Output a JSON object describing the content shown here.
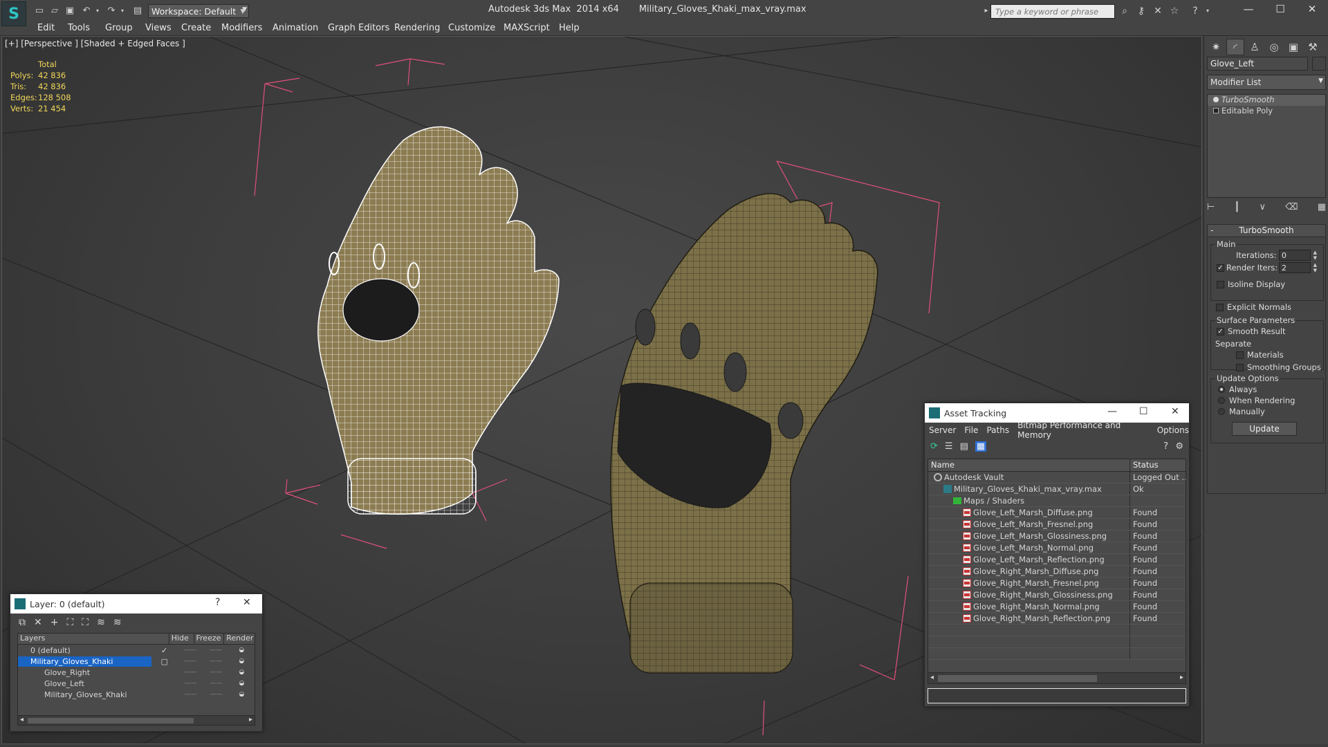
{
  "titlebar": {
    "title": "Autodesk 3ds Max  2014 x64       Military_Gloves_Khaki_max_vray.max",
    "workspace": "Workspace: Default",
    "search_placeholder": "Type a keyword or phrase"
  },
  "menu": [
    "Edit",
    "Tools",
    "Group",
    "Views",
    "Create",
    "Modifiers",
    "Animation",
    "Graph Editors",
    "Rendering",
    "Customize",
    "MAXScript",
    "Help"
  ],
  "viewport": {
    "label": "[+] [Perspective ] [Shaded + Edged Faces ]",
    "stats": {
      "header": "Total",
      "rows": [
        {
          "key": "Polys:",
          "value": "42 836"
        },
        {
          "key": "Tris:",
          "value": "42 836"
        },
        {
          "key": "Edges:",
          "value": "128 508"
        },
        {
          "key": "Verts:",
          "value": "21 454"
        }
      ]
    }
  },
  "command_panel": {
    "object_name": "Glove_Left",
    "modifier_list": "Modifier List",
    "stack": [
      "TurboSmooth",
      "Editable Poly"
    ],
    "turbosmooth": {
      "title": "TurboSmooth",
      "main_label": "Main",
      "iterations_label": "Iterations:",
      "iterations_value": "0",
      "render_iters_label": "Render Iters:",
      "render_iters_value": "2",
      "isoline_label": "Isoline Display",
      "explicit_normals_label": "Explicit Normals",
      "surface_params_label": "Surface Parameters",
      "smooth_result_label": "Smooth Result",
      "separate_label": "Separate",
      "materials_label": "Materials",
      "smoothing_groups_label": "Smoothing Groups",
      "update_options_label": "Update Options",
      "always_label": "Always",
      "when_rendering_label": "When Rendering",
      "manually_label": "Manually",
      "update_button": "Update"
    }
  },
  "layer_window": {
    "title": "Layer: 0 (default)",
    "help": "?",
    "columns": [
      "Layers",
      "Hide",
      "Freeze",
      "Render"
    ],
    "rows": [
      {
        "name": "0 (default)",
        "indent": 1
      },
      {
        "name": "Military_Gloves_Khaki",
        "indent": 1
      },
      {
        "name": "Glove_Right",
        "indent": 2
      },
      {
        "name": "Glove_Left",
        "indent": 2
      },
      {
        "name": "Military_Gloves_Khaki",
        "indent": 2
      }
    ]
  },
  "asset_window": {
    "title": "Asset Tracking",
    "menu": [
      "Server",
      "File",
      "Paths",
      "Bitmap Performance and Memory",
      "Options"
    ],
    "columns": [
      "Name",
      "Status"
    ],
    "rows": [
      {
        "name": "Autodesk Vault",
        "status": "Logged Out ...",
        "icon": "vault-icon",
        "indent": 1
      },
      {
        "name": "Military_Gloves_Khaki_max_vray.max",
        "status": "Ok",
        "icon": "max-file-icon",
        "indent": 2
      },
      {
        "name": "Maps / Shaders",
        "status": "",
        "icon": "folder-icon",
        "indent": 3
      },
      {
        "name": "Glove_Left_Marsh_Diffuse.png",
        "status": "Found",
        "icon": "png-icon",
        "indent": 4
      },
      {
        "name": "Glove_Left_Marsh_Fresnel.png",
        "status": "Found",
        "icon": "png-icon",
        "indent": 4
      },
      {
        "name": "Glove_Left_Marsh_Glossiness.png",
        "status": "Found",
        "icon": "png-icon",
        "indent": 4
      },
      {
        "name": "Glove_Left_Marsh_Normal.png",
        "status": "Found",
        "icon": "png-icon",
        "indent": 4
      },
      {
        "name": "Glove_Left_Marsh_Reflection.png",
        "status": "Found",
        "icon": "png-icon",
        "indent": 4
      },
      {
        "name": "Glove_Right_Marsh_Diffuse.png",
        "status": "Found",
        "icon": "png-icon",
        "indent": 4
      },
      {
        "name": "Glove_Right_Marsh_Fresnel.png",
        "status": "Found",
        "icon": "png-icon",
        "indent": 4
      },
      {
        "name": "Glove_Right_Marsh_Glossiness.png",
        "status": "Found",
        "icon": "png-icon",
        "indent": 4
      },
      {
        "name": "Glove_Right_Marsh_Normal.png",
        "status": "Found",
        "icon": "png-icon",
        "indent": 4
      },
      {
        "name": "Glove_Right_Marsh_Reflection.png",
        "status": "Found",
        "icon": "png-icon",
        "indent": 4
      }
    ]
  },
  "colors": {
    "accent": "#1a64c4",
    "stats_text": "#f1d75a",
    "bounding_box": "#e0507a",
    "glove_khaki": "#7c7048"
  }
}
